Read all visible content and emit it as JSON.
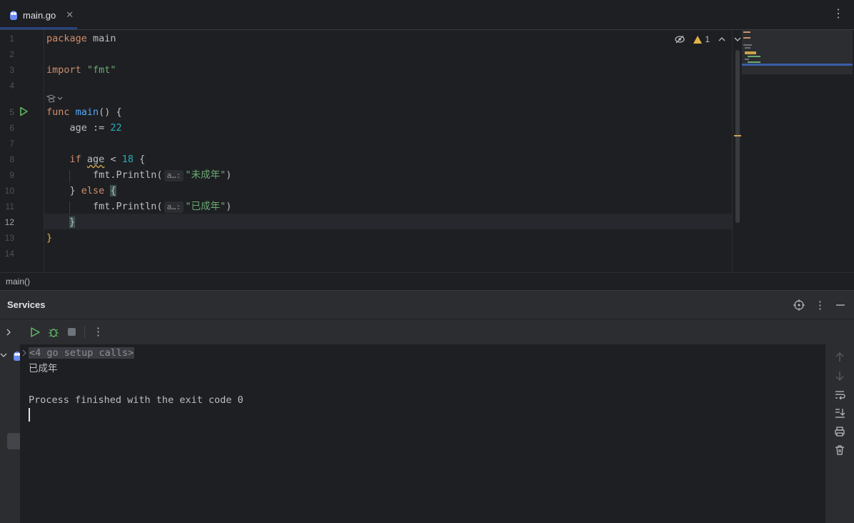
{
  "tab": {
    "label": "main.go",
    "close": "✕"
  },
  "editor": {
    "line_numbers": [
      "1",
      "2",
      "3",
      "4",
      "5",
      "6",
      "7",
      "8",
      "9",
      "10",
      "11",
      "12",
      "13",
      "14"
    ],
    "code": {
      "l1_kw": "package",
      "l1_id": " main",
      "l3_kw": "import",
      "l3_str": " \"fmt\"",
      "l5_kw": "func",
      "l5_fn": " main",
      "l5_rest": "() {",
      "l6_id": "    age := ",
      "l6_num": "22",
      "l8_kw": "    if",
      "l8_sp": " ",
      "l8_id": "age",
      "l8_op": " < ",
      "l8_num": "18",
      "l8_brace": " {",
      "l9_call": "        fmt.Println(",
      "l9_hint": "a…:",
      "l9_str": "\"未成年\"",
      "l9_end": ")",
      "l10_a": "    } ",
      "l10_kw": "else",
      "l10_sp": " ",
      "l10_brace": "{",
      "l11_call": "        fmt.Println(",
      "l11_hint": "a…:",
      "l11_str": "\"已成年\"",
      "l11_end": ")",
      "l12_brace": "}",
      "l13_brace": "}"
    },
    "warning_count": "1",
    "breadcrumb": "main()"
  },
  "services": {
    "title": "Services",
    "console": {
      "setup": "<4 go setup calls>",
      "output": "已成年",
      "finished": "Process finished with the exit code 0"
    }
  },
  "colors": {
    "accent": "#3574f0",
    "keyword": "#cf8e6d",
    "function": "#56a8f5",
    "string": "#6aab73",
    "number": "#2aacb8",
    "run": "#5fb865",
    "warning": "#e0b34a"
  }
}
